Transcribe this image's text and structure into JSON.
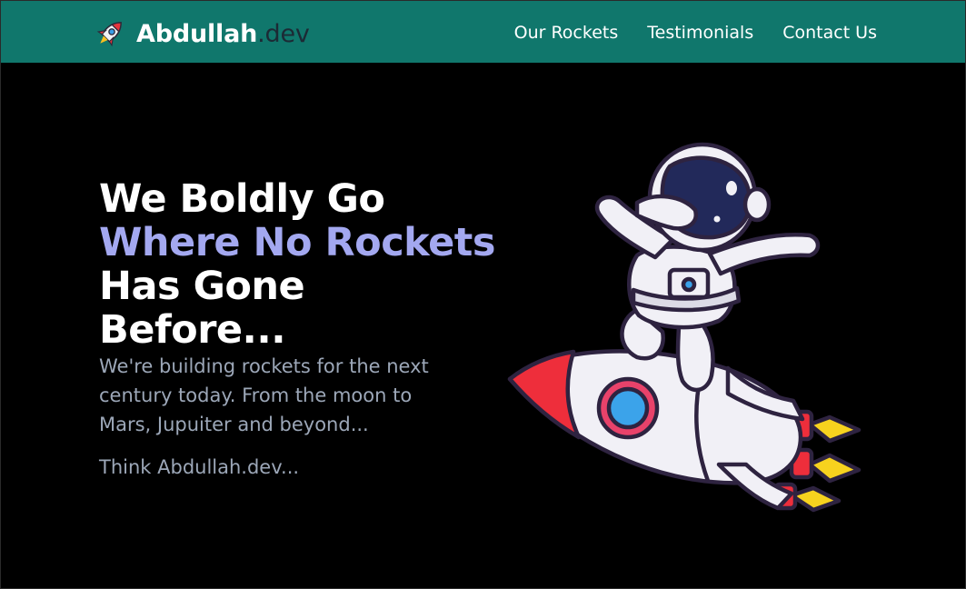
{
  "colors": {
    "navbar_bg": "#10776c",
    "page_bg": "#000000",
    "headline": "#ffffff",
    "headline_accent": "#a3a8f0",
    "body_text": "#9ca7b8",
    "brand_suffix": "#1c2a35"
  },
  "brand": {
    "icon": "rocket-icon",
    "name": "Abdullah",
    "suffix": ".dev"
  },
  "nav": {
    "items": [
      {
        "label": "Our Rockets"
      },
      {
        "label": "Testimonials"
      },
      {
        "label": "Contact Us"
      }
    ]
  },
  "hero": {
    "headline": {
      "part1": "We Boldly Go",
      "accent": "Where No Rockets",
      "part2": "Has Gone Before..."
    },
    "subtext": "We're building rockets for the next century today. From the moon to Mars, Jupuiter and beyond...",
    "tagline": "Think Abdullah.dev...",
    "illustration": "astronaut-riding-rocket-illustration"
  }
}
